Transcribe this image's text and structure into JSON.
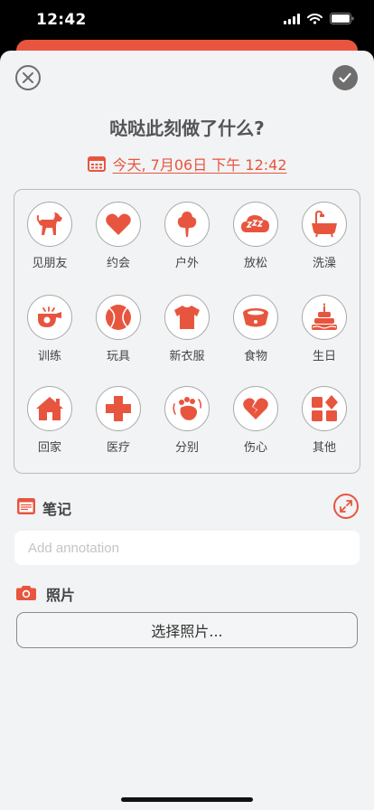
{
  "status_bar": {
    "time": "12:42"
  },
  "header": {
    "title": "哒哒此刻做了什么?"
  },
  "date": {
    "text": "今天, 7月06日 下午 12:42"
  },
  "activities": [
    {
      "label": "见朋友",
      "icon": "dog-icon"
    },
    {
      "label": "约会",
      "icon": "heart-icon"
    },
    {
      "label": "户外",
      "icon": "tree-icon"
    },
    {
      "label": "放松",
      "icon": "sleep-cloud-icon"
    },
    {
      "label": "洗澡",
      "icon": "bathtub-icon"
    },
    {
      "label": "训练",
      "icon": "whistle-icon"
    },
    {
      "label": "玩具",
      "icon": "ball-icon"
    },
    {
      "label": "新衣服",
      "icon": "shirt-icon"
    },
    {
      "label": "食物",
      "icon": "food-bowl-icon"
    },
    {
      "label": "生日",
      "icon": "cake-icon"
    },
    {
      "label": "回家",
      "icon": "house-icon"
    },
    {
      "label": "医疗",
      "icon": "medical-cross-icon"
    },
    {
      "label": "分别",
      "icon": "paw-wave-icon"
    },
    {
      "label": "伤心",
      "icon": "broken-heart-icon"
    },
    {
      "label": "其他",
      "icon": "grid-shapes-icon"
    }
  ],
  "notes": {
    "label": "笔记",
    "placeholder": "Add annotation"
  },
  "photos": {
    "label": "照片",
    "button": "选择照片..."
  },
  "colors": {
    "accent": "#e8553f",
    "background": "#f1f3f4",
    "grey": "#6e6e6e"
  }
}
